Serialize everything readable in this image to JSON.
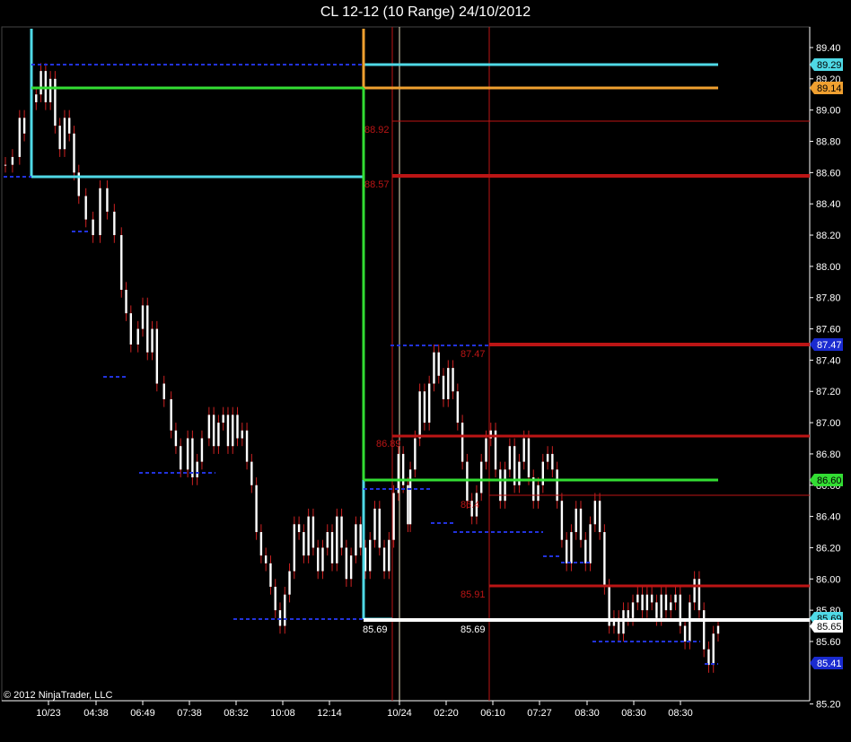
{
  "window": {
    "title": "CL 12-12 (10 Range)  24/10/2012"
  },
  "copyright": "© 2012 NinjaTrader, LLC",
  "colors": {
    "background": "#000000",
    "axis": "#ffffff",
    "bar_up": "#ffffff",
    "bar_wick": "#cc2222",
    "cyan": "#4fd9e6",
    "orange": "#f0a030",
    "green": "#33dd33",
    "darkred": "#bb1515",
    "blue_dash": "#2233dd",
    "white_line": "#ffffff"
  },
  "chart_data": {
    "type": "line",
    "title": "CL 12-12 (10 Range)  24/10/2012",
    "ylim": [
      85.2,
      89.5
    ],
    "yticks": [
      "89.40",
      "89.20",
      "89.00",
      "88.80",
      "88.60",
      "88.40",
      "88.20",
      "88.00",
      "87.80",
      "87.60",
      "87.40",
      "87.20",
      "87.00",
      "86.80",
      "86.60",
      "86.40",
      "86.20",
      "86.00",
      "85.80",
      "85.60",
      "85.20"
    ],
    "xticks": [
      "10/23",
      "04:38",
      "06:49",
      "07:38",
      "08:32",
      "10:08",
      "12:14",
      "10/24",
      "02:20",
      "06:10",
      "07:27",
      "08:30",
      "08:30",
      "08:30"
    ],
    "price_series": [
      [
        0,
        88.65
      ],
      [
        3,
        88.7
      ],
      [
        6,
        88.95
      ],
      [
        8,
        88.85
      ],
      [
        11,
        89.05
      ],
      [
        13,
        89.1
      ],
      [
        15,
        89.25
      ],
      [
        17,
        89.05
      ],
      [
        19,
        89.2
      ],
      [
        21,
        88.9
      ],
      [
        23,
        88.75
      ],
      [
        25,
        88.95
      ],
      [
        27,
        88.85
      ],
      [
        29,
        88.6
      ],
      [
        31,
        88.45
      ],
      [
        34,
        88.3
      ],
      [
        37,
        88.2
      ],
      [
        40,
        88.5
      ],
      [
        43,
        88.35
      ],
      [
        46,
        88.2
      ],
      [
        49,
        87.85
      ],
      [
        51,
        87.7
      ],
      [
        53,
        87.5
      ],
      [
        56,
        87.6
      ],
      [
        58,
        87.75
      ],
      [
        60,
        87.45
      ],
      [
        62,
        87.6
      ],
      [
        64,
        87.25
      ],
      [
        67,
        87.15
      ],
      [
        70,
        86.95
      ],
      [
        72,
        86.85
      ],
      [
        74,
        86.7
      ],
      [
        77,
        86.9
      ],
      [
        79,
        86.65
      ],
      [
        81,
        86.75
      ],
      [
        83,
        86.9
      ],
      [
        86,
        87.05
      ],
      [
        88,
        86.85
      ],
      [
        90,
        87.0
      ],
      [
        92,
        87.05
      ],
      [
        94,
        86.85
      ],
      [
        96,
        87.05
      ],
      [
        98,
        86.9
      ],
      [
        100,
        86.95
      ],
      [
        102,
        86.75
      ],
      [
        104,
        86.6
      ],
      [
        106,
        86.3
      ],
      [
        108,
        86.15
      ],
      [
        110,
        86.1
      ],
      [
        112,
        85.95
      ],
      [
        114,
        85.8
      ],
      [
        116,
        85.7
      ],
      [
        118,
        85.9
      ],
      [
        120,
        86.05
      ],
      [
        122,
        86.35
      ],
      [
        124,
        86.3
      ],
      [
        126,
        86.15
      ],
      [
        128,
        86.4
      ],
      [
        130,
        86.2
      ],
      [
        132,
        86.05
      ],
      [
        134,
        86.2
      ],
      [
        136,
        86.3
      ],
      [
        138,
        86.1
      ],
      [
        140,
        86.4
      ],
      [
        142,
        86.2
      ],
      [
        144,
        86.0
      ],
      [
        146,
        86.15
      ],
      [
        148,
        86.35
      ],
      [
        150,
        86.2
      ],
      [
        152,
        86.05
      ],
      [
        154,
        86.25
      ],
      [
        156,
        86.45
      ],
      [
        158,
        86.2
      ],
      [
        160,
        86.05
      ],
      [
        162,
        86.25
      ],
      [
        164,
        86.55
      ],
      [
        166,
        86.8
      ],
      [
        168,
        86.6
      ],
      [
        170,
        86.35
      ],
      [
        171,
        86.7
      ],
      [
        173,
        86.9
      ],
      [
        175,
        87.2
      ],
      [
        177,
        87.0
      ],
      [
        179,
        87.25
      ],
      [
        181,
        87.45
      ],
      [
        183,
        87.3
      ],
      [
        185,
        87.15
      ],
      [
        187,
        87.35
      ],
      [
        189,
        87.2
      ],
      [
        191,
        87.0
      ],
      [
        193,
        86.75
      ],
      [
        195,
        86.5
      ],
      [
        197,
        86.4
      ],
      [
        199,
        86.55
      ],
      [
        201,
        86.75
      ],
      [
        203,
        86.9
      ],
      [
        205,
        86.95
      ],
      [
        207,
        86.7
      ],
      [
        209,
        86.5
      ],
      [
        211,
        86.7
      ],
      [
        213,
        86.85
      ],
      [
        215,
        86.6
      ],
      [
        217,
        86.75
      ],
      [
        219,
        86.9
      ],
      [
        221,
        86.65
      ],
      [
        223,
        86.5
      ],
      [
        225,
        86.6
      ],
      [
        227,
        86.75
      ],
      [
        229,
        86.8
      ],
      [
        231,
        86.7
      ],
      [
        233,
        86.5
      ],
      [
        235,
        86.25
      ],
      [
        237,
        86.1
      ],
      [
        239,
        86.3
      ],
      [
        241,
        86.45
      ],
      [
        243,
        86.25
      ],
      [
        245,
        86.1
      ],
      [
        247,
        86.35
      ],
      [
        249,
        86.5
      ],
      [
        251,
        86.3
      ],
      [
        253,
        85.95
      ],
      [
        255,
        85.7
      ],
      [
        257,
        85.75
      ],
      [
        259,
        85.65
      ],
      [
        261,
        85.8
      ],
      [
        263,
        85.75
      ],
      [
        265,
        85.85
      ],
      [
        267,
        85.9
      ],
      [
        269,
        85.8
      ],
      [
        271,
        85.9
      ],
      [
        273,
        85.85
      ],
      [
        275,
        85.75
      ],
      [
        277,
        85.9
      ],
      [
        279,
        85.8
      ],
      [
        281,
        85.85
      ],
      [
        283,
        85.9
      ],
      [
        285,
        85.7
      ],
      [
        287,
        85.6
      ],
      [
        289,
        85.85
      ],
      [
        291,
        86.0
      ],
      [
        293,
        85.8
      ],
      [
        295,
        85.55
      ],
      [
        297,
        85.45
      ],
      [
        299,
        85.65
      ],
      [
        301,
        85.7
      ]
    ],
    "price_series_x_range": [
      0,
      301
    ],
    "levels": [
      {
        "name": "cyan-top",
        "price": 89.29,
        "color": "cyan",
        "label": "89.29"
      },
      {
        "name": "orange-top",
        "price": 89.14,
        "color": "orange",
        "label": "89.14"
      },
      {
        "name": "green-mid",
        "price": 86.6,
        "color": "green",
        "label": "86.60"
      },
      {
        "name": "blue-4747",
        "price": 87.47,
        "color": "blue",
        "label": "87.47"
      },
      {
        "name": "blue-8541",
        "price": 85.41,
        "color": "blue",
        "label": "85.41"
      },
      {
        "name": "white-8565",
        "price": 85.65,
        "color": "white",
        "label": "85.65"
      },
      {
        "name": "cyan-8569",
        "price": 85.69,
        "color": "cyan",
        "label": "85.69"
      }
    ],
    "annotations": [
      "88.92",
      "88.57",
      "87.47",
      "86.89",
      "86.4",
      "85.91",
      "85.69",
      "85.69"
    ]
  },
  "price_labels": {
    "p89_29": "89.29",
    "p89_14": "89.14",
    "p87_47": "87.47",
    "p86_60": "86.60",
    "p85_65": "85.65",
    "p85_69": "85.69",
    "p85_41": "85.41"
  },
  "notes": {
    "a1": "88.92",
    "a2": "88.57",
    "a3": "87.47",
    "a4": "86.89",
    "a5": "86.4",
    "a6": "85.91",
    "a7": "85.69",
    "a8": "85.69"
  }
}
